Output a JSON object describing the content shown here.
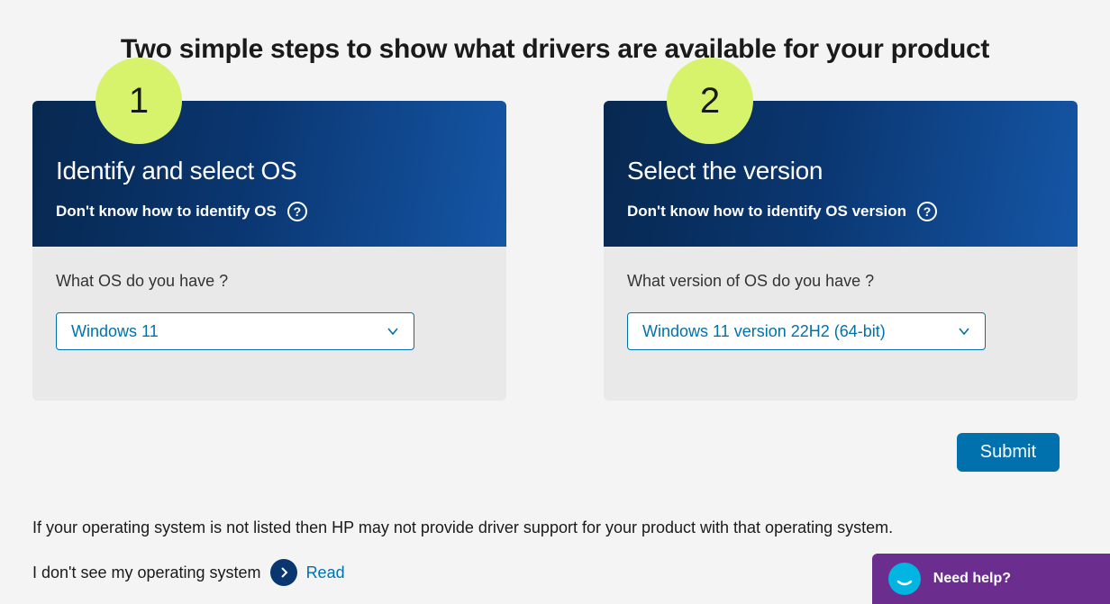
{
  "page_title": "Two simple steps to show what drivers are available for your product",
  "cards": [
    {
      "badge": "1",
      "title": "Identify and select OS",
      "help_text": "Don't know how to identify OS",
      "question": "What OS do you have ?",
      "select_value": "Windows 11"
    },
    {
      "badge": "2",
      "title": "Select the version",
      "help_text": "Don't know how to identify OS version",
      "question": "What version of OS do you have ?",
      "select_value": "Windows 11 version 22H2 (64-bit)"
    }
  ],
  "submit_label": "Submit",
  "info_text": "If your operating system is not listed then HP may not provide driver support for your product with that operating system.",
  "read_label": "I don't see my operating system",
  "read_link": "Read",
  "chat_label": "Need help?"
}
